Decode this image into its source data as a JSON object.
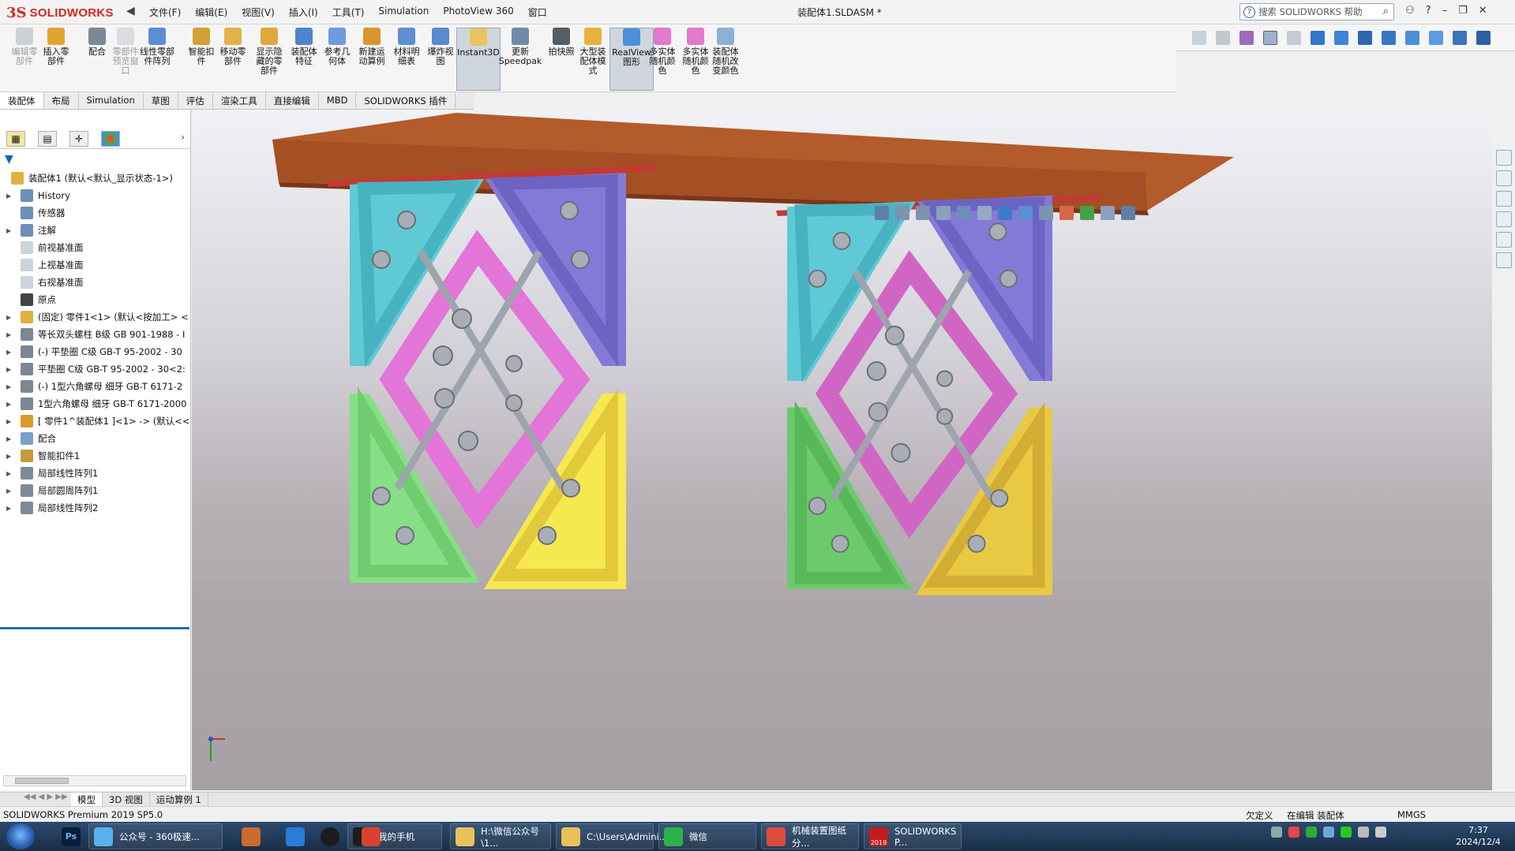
{
  "app": {
    "brand": "SOLIDWORKS",
    "ds_mark": "3S",
    "document_title": "装配体1.SLDASM *"
  },
  "menu": [
    "文件(F)",
    "编辑(E)",
    "视图(V)",
    "插入(I)",
    "工具(T)",
    "Simulation",
    "PhotoView 360",
    "窗口"
  ],
  "search": {
    "placeholder": "搜索 SOLIDWORKS 帮助"
  },
  "commands": [
    {
      "label": "编辑零\n部件",
      "icon": "edit-component-icon",
      "disabled": true
    },
    {
      "label": "插入零\n部件",
      "icon": "insert-component-icon"
    },
    {
      "label": "配合",
      "icon": "mate-icon"
    },
    {
      "label": "零部件\n预览窗\n口",
      "icon": "component-preview-icon",
      "disabled": true
    },
    {
      "label": "线性零部\n件阵列",
      "icon": "linear-pattern-icon"
    },
    {
      "label": "智能扣\n件",
      "icon": "smart-fasteners-icon"
    },
    {
      "label": "移动零\n部件",
      "icon": "move-component-icon"
    },
    {
      "label": "显示隐\n藏的零\n部件",
      "icon": "show-hidden-icon"
    },
    {
      "label": "装配体\n特征",
      "icon": "assembly-features-icon"
    },
    {
      "label": "参考几\n何体",
      "icon": "reference-geometry-icon"
    },
    {
      "label": "新建运\n动算例",
      "icon": "motion-study-icon"
    },
    {
      "label": "材料明\n细表",
      "icon": "bom-icon"
    },
    {
      "label": "爆炸视\n图",
      "icon": "exploded-view-icon"
    },
    {
      "label": "Instant3D",
      "icon": "instant3d-icon",
      "active": true
    },
    {
      "label": "更新\nSpeedpak",
      "icon": "speedpak-icon"
    },
    {
      "label": "拍快照",
      "icon": "snapshot-icon"
    },
    {
      "label": "大型装\n配体模\n式",
      "icon": "large-assembly-icon"
    },
    {
      "label": "RealView\n图形",
      "icon": "realview-icon",
      "active": true
    },
    {
      "label": "多实体\n随机颜\n色",
      "icon": "random-color-icon"
    },
    {
      "label": "多实体\n随机颜\n色",
      "icon": "random-color-icon"
    },
    {
      "label": "装配体\n随机改\n变颜色",
      "icon": "assembly-random-color-icon"
    }
  ],
  "tabs": [
    "装配体",
    "布局",
    "Simulation",
    "草图",
    "评估",
    "渲染工具",
    "直接编辑",
    "MBD",
    "SOLIDWORKS 插件"
  ],
  "tree": [
    {
      "label": "装配体1  (默认<默认_显示状态-1>)",
      "icon": "assembly-icon",
      "level": 0,
      "expand": ""
    },
    {
      "label": "History",
      "icon": "history-icon",
      "level": 1,
      "expand": "▶"
    },
    {
      "label": "传感器",
      "icon": "sensor-icon",
      "level": 1,
      "expand": ""
    },
    {
      "label": "注解",
      "icon": "annotation-icon",
      "level": 1,
      "expand": "▶"
    },
    {
      "label": "前视基准面",
      "icon": "plane-icon",
      "level": 1,
      "expand": ""
    },
    {
      "label": "上视基准面",
      "icon": "plane-icon",
      "level": 1,
      "expand": ""
    },
    {
      "label": "右视基准面",
      "icon": "plane-icon",
      "level": 1,
      "expand": ""
    },
    {
      "label": "原点",
      "icon": "origin-icon",
      "level": 1,
      "expand": ""
    },
    {
      "label": "(固定) 零件1<1> (默认<按加工> <",
      "icon": "part-icon",
      "level": 1,
      "expand": "▶"
    },
    {
      "label": "等长双头螺柱 B级 GB 901-1988 - I",
      "icon": "fastener-icon",
      "level": 1,
      "expand": "▶"
    },
    {
      "label": "(-) 平垫圈 C级 GB-T 95-2002 - 30",
      "icon": "fastener-icon",
      "level": 1,
      "expand": "▶"
    },
    {
      "label": "平垫圈 C级 GB-T 95-2002 - 30<2:",
      "icon": "fastener-icon",
      "level": 1,
      "expand": "▶"
    },
    {
      "label": "(-) 1型六角螺母 细牙 GB-T 6171-2",
      "icon": "fastener-icon",
      "level": 1,
      "expand": "▶"
    },
    {
      "label": "1型六角螺母 细牙 GB-T 6171-2000",
      "icon": "fastener-icon",
      "level": 1,
      "expand": "▶"
    },
    {
      "label": "[ 零件1^装配体1 ]<1> -> (默认<<",
      "icon": "virtual-part-icon",
      "level": 1,
      "expand": "▶"
    },
    {
      "label": "配合",
      "icon": "mates-folder-icon",
      "level": 1,
      "expand": "▶"
    },
    {
      "label": "智能扣件1",
      "icon": "smart-fastener-icon",
      "level": 1,
      "expand": "▶"
    },
    {
      "label": "局部线性阵列1",
      "icon": "pattern-icon",
      "level": 1,
      "expand": "▶"
    },
    {
      "label": "局部圆周阵列1",
      "icon": "circular-pattern-icon",
      "level": 1,
      "expand": "▶"
    },
    {
      "label": "局部线性阵列2",
      "icon": "pattern-icon",
      "level": 1,
      "expand": "▶"
    }
  ],
  "bottom_tabs": [
    "模型",
    "3D 视图",
    "运动算例 1"
  ],
  "status": {
    "version": "SOLIDWORKS Premium 2019 SP5.0",
    "defined": "欠定义",
    "editing": "在编辑 装配体",
    "units": "MMGS"
  },
  "taskbar": {
    "apps": [
      {
        "label": "公众号 - 360极速...",
        "icon": "browser-360-icon"
      },
      {
        "label": "我的手机",
        "icon": "qq-icon"
      },
      {
        "label": "H:\\微信公众号\\1...",
        "icon": "folder-icon"
      },
      {
        "label": "C:\\Users\\Admini...",
        "icon": "folder-icon"
      },
      {
        "label": "微信",
        "icon": "wechat-icon"
      },
      {
        "label": "机械装置图纸分...",
        "icon": "chrome-icon"
      },
      {
        "label": "SOLIDWORKS P...",
        "icon": "solidworks-icon"
      }
    ],
    "pinned": [
      "photoshop-icon",
      "paint-icon",
      "flag-icon",
      "record-icon",
      "tool-icon"
    ],
    "ps_label": "Ps",
    "sw_badge": "2019",
    "clock_time": "7:37",
    "clock_date": "2024/12/4"
  }
}
